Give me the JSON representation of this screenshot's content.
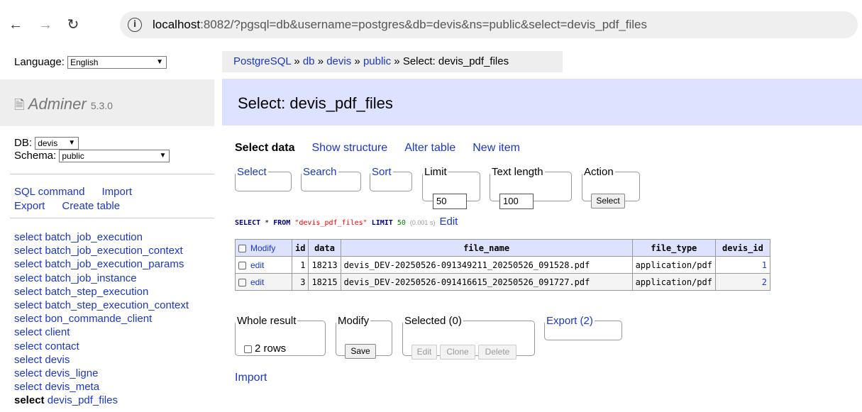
{
  "browser": {
    "url_host": "localhost",
    "url_rest": ":8082/?pgsql=db&username=postgres&db=devis&ns=public&select=devis_pdf_files"
  },
  "sidebar": {
    "language_label": "Language:",
    "language_value": "English",
    "logo_text": "Adminer",
    "version": "5.3.0",
    "db_label": "DB:",
    "db_value": "devis",
    "schema_label": "Schema:",
    "schema_value": "public",
    "links": [
      "SQL command",
      "Import",
      "Export",
      "Create table"
    ],
    "tables_prefix": "select",
    "tables": [
      "batch_job_execution",
      "batch_job_execution_context",
      "batch_job_execution_params",
      "batch_job_instance",
      "batch_step_execution",
      "batch_step_execution_context",
      "bon_commande_client",
      "client",
      "contact",
      "devis",
      "devis_ligne",
      "devis_meta",
      "devis_pdf_files"
    ]
  },
  "breadcrumb": {
    "items": [
      "PostgreSQL",
      "db",
      "devis",
      "public"
    ],
    "sep": " » ",
    "current": "Select: devis_pdf_files"
  },
  "title": "Select: devis_pdf_files",
  "tabs": [
    "Select data",
    "Show structure",
    "Alter table",
    "New item"
  ],
  "filters": {
    "select": "Select",
    "search": "Search",
    "sort": "Sort",
    "limit_label": "Limit",
    "limit_value": "50",
    "text_length_label": "Text length",
    "text_length_value": "100",
    "action_label": "Action",
    "action_button": "Select"
  },
  "query": {
    "kw1": "SELECT",
    "star": " * ",
    "kw2": "FROM",
    "table": "\"devis_pdf_files\"",
    "kw3": "LIMIT",
    "limit": "50",
    "time": "(0.001 s)",
    "edit": "Edit"
  },
  "table": {
    "modify_header": "Modify",
    "columns": [
      "id",
      "data",
      "file_name",
      "file_type",
      "devis_id"
    ],
    "rows": [
      {
        "edit": "edit",
        "id": "1",
        "data": "18213",
        "file_name": "devis_DEV-20250526-091349211_20250526_091528.pdf",
        "file_type": "application/pdf",
        "devis_id": "1"
      },
      {
        "edit": "edit",
        "id": "3",
        "data": "18215",
        "file_name": "devis_DEV-20250526-091416615_20250526_091727.pdf",
        "file_type": "application/pdf",
        "devis_id": "2"
      }
    ]
  },
  "bottom": {
    "whole_result": "Whole result",
    "rows_label": "2 rows",
    "modify": "Modify",
    "save": "Save",
    "selected": "Selected (0)",
    "edit": "Edit",
    "clone": "Clone",
    "delete": "Delete",
    "export": "Export (2)",
    "import": "Import"
  }
}
